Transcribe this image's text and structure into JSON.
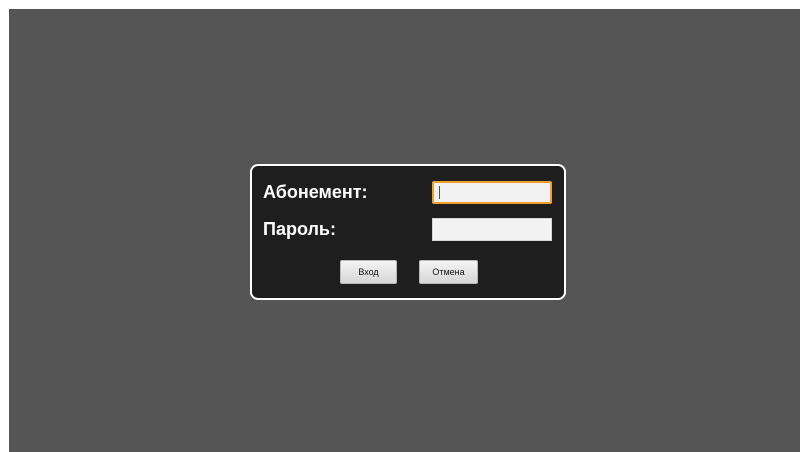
{
  "login_dialog": {
    "subscription_label": "Абонемент:",
    "subscription_value": "",
    "password_label": "Пароль:",
    "password_value": "",
    "login_button": "Вход",
    "cancel_button": "Отмена"
  },
  "colors": {
    "background": "#555555",
    "dialog": "#1e1e1e",
    "focus_border": "#f0a030"
  }
}
